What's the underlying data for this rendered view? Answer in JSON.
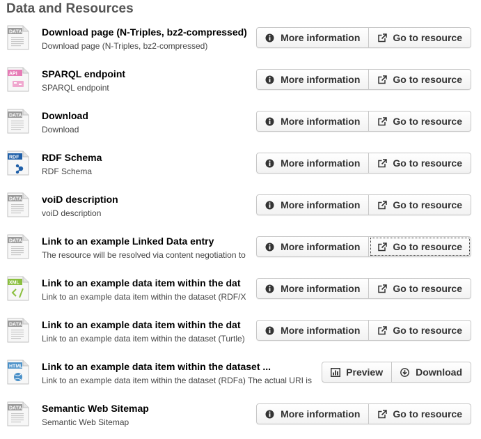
{
  "section": {
    "title": "Data and Resources"
  },
  "resources": [
    {
      "format": "DATA",
      "format_color": "#9a9a9a",
      "title": "Download page (N-Triples, bz2-compressed)",
      "description": "Download page (N-Triples, bz2-compressed)",
      "buttons": [
        {
          "label": "More information",
          "icon": "info-icon"
        },
        {
          "label": "Go to resource",
          "icon": "external-link-icon"
        }
      ]
    },
    {
      "format": "API",
      "format_color": "#e67cb6",
      "title": "SPARQL endpoint",
      "description": "SPARQL endpoint",
      "buttons": [
        {
          "label": "More information",
          "icon": "info-icon"
        },
        {
          "label": "Go to resource",
          "icon": "external-link-icon"
        }
      ]
    },
    {
      "format": "DATA",
      "format_color": "#9a9a9a",
      "title": "Download",
      "description": "Download",
      "buttons": [
        {
          "label": "More information",
          "icon": "info-icon"
        },
        {
          "label": "Go to resource",
          "icon": "external-link-icon"
        }
      ]
    },
    {
      "format": "RDF",
      "format_color": "#1f5fa8",
      "title": "RDF Schema",
      "description": "RDF Schema",
      "buttons": [
        {
          "label": "More information",
          "icon": "info-icon"
        },
        {
          "label": "Go to resource",
          "icon": "external-link-icon"
        }
      ]
    },
    {
      "format": "DATA",
      "format_color": "#9a9a9a",
      "title": "voiD description",
      "description": "voiD description",
      "buttons": [
        {
          "label": "More information",
          "icon": "info-icon"
        },
        {
          "label": "Go to resource",
          "icon": "external-link-icon"
        }
      ]
    },
    {
      "format": "DATA",
      "format_color": "#9a9a9a",
      "title": "Link to an example Linked Data entry",
      "description": "The resource will be resolved via content negotiation to",
      "focused_button": 1,
      "buttons": [
        {
          "label": "More information",
          "icon": "info-icon"
        },
        {
          "label": "Go to resource",
          "icon": "external-link-icon"
        }
      ]
    },
    {
      "format": "XML",
      "format_color": "#8bbf3f",
      "title": "Link to an example data item within the dat",
      "description": "Link to an example data item within the dataset (RDF/X",
      "buttons": [
        {
          "label": "More information",
          "icon": "info-icon"
        },
        {
          "label": "Go to resource",
          "icon": "external-link-icon"
        }
      ]
    },
    {
      "format": "DATA",
      "format_color": "#9a9a9a",
      "title": "Link to an example data item within the dat",
      "description": "Link to an example data item within the dataset (Turtle)",
      "buttons": [
        {
          "label": "More information",
          "icon": "info-icon"
        },
        {
          "label": "Go to resource",
          "icon": "external-link-icon"
        }
      ]
    },
    {
      "format": "HTML",
      "format_color": "#4a90c8",
      "title": "Link to an example data item within the dataset ...",
      "description": "Link to an example data item within the dataset (RDFa) The actual URI is",
      "buttons": [
        {
          "label": "Preview",
          "icon": "bar-chart-icon"
        },
        {
          "label": "Download",
          "icon": "download-icon"
        }
      ]
    },
    {
      "format": "DATA",
      "format_color": "#9a9a9a",
      "title": "Semantic Web Sitemap",
      "description": "Semantic Web Sitemap",
      "buttons": [
        {
          "label": "More information",
          "icon": "info-icon"
        },
        {
          "label": "Go to resource",
          "icon": "external-link-icon"
        }
      ]
    }
  ]
}
